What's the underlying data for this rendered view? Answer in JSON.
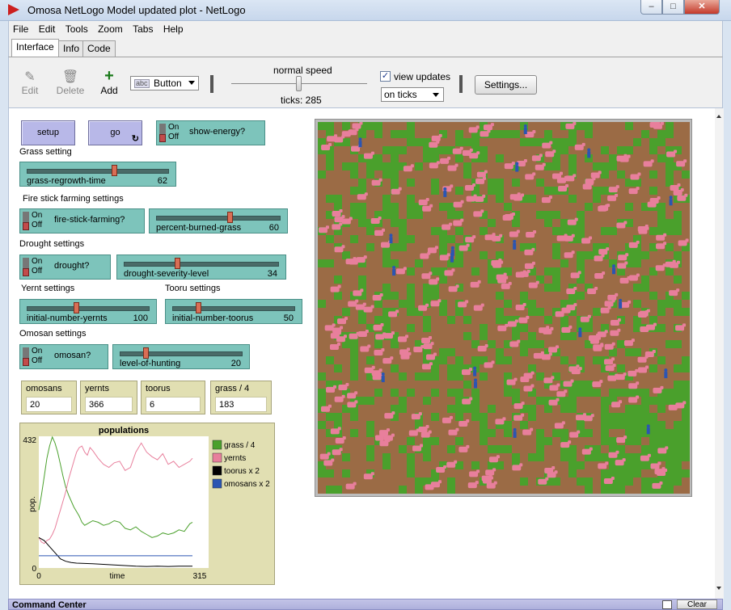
{
  "window": {
    "title": "Omosa NetLogo Model updated plot - NetLogo"
  },
  "menu": [
    "File",
    "Edit",
    "Tools",
    "Zoom",
    "Tabs",
    "Help"
  ],
  "tabs": [
    "Interface",
    "Info",
    "Code"
  ],
  "toolbar": {
    "edit": "Edit",
    "delete": "Delete",
    "add": "Add",
    "widget_type": "Button",
    "speed_label": "normal speed",
    "ticks_label": "ticks: 285",
    "speed_fraction": 0.5,
    "view_updates_label": "view updates",
    "view_updates_checked": true,
    "update_mode": "on ticks",
    "settings": "Settings..."
  },
  "buttons": {
    "setup": "setup",
    "go": "go"
  },
  "switches": {
    "show_energy": {
      "label": "show-energy?",
      "on": "On",
      "off": "Off",
      "value": false
    },
    "fire_stick": {
      "label": "fire-stick-farming?",
      "on": "On",
      "off": "Off",
      "value": false
    },
    "drought": {
      "label": "drought?",
      "on": "On",
      "off": "Off",
      "value": false
    },
    "omosan": {
      "label": "omosan?",
      "on": "On",
      "off": "Off",
      "value": false
    }
  },
  "sections": {
    "grass": "Grass setting",
    "fire": "Fire stick farming settings",
    "drought": "Drought settings",
    "yernt": "Yernt settings",
    "tooru": "Tooru settings",
    "omosan": "Omosan settings"
  },
  "sliders": {
    "grass_regrowth": {
      "name": "grass-regrowth-time",
      "value": "62",
      "fraction": 0.62
    },
    "percent_burned": {
      "name": "percent-burned-grass",
      "value": "60",
      "fraction": 0.6
    },
    "drought_severity": {
      "name": "drought-severity-level",
      "value": "34",
      "fraction": 0.34
    },
    "initial_yernts": {
      "name": "initial-number-yernts",
      "value": "100",
      "fraction": 0.4
    },
    "initial_toorus": {
      "name": "initial-number-toorus",
      "value": "50",
      "fraction": 0.2
    },
    "level_hunting": {
      "name": "level-of-hunting",
      "value": "20",
      "fraction": 0.2
    }
  },
  "monitors": [
    {
      "name": "omosans",
      "value": "20"
    },
    {
      "name": "yernts",
      "value": "366"
    },
    {
      "name": "toorus",
      "value": "6"
    },
    {
      "name": "grass / 4",
      "value": "183"
    }
  ],
  "chart_data": {
    "type": "line",
    "title": "populations",
    "xlabel": "time",
    "ylabel": "pop.",
    "xlim": [
      0,
      315
    ],
    "ylim": [
      0,
      432
    ],
    "x_ticks": [
      "0",
      "315"
    ],
    "y_ticks": [
      "0",
      "432"
    ],
    "legend_position": "right",
    "series": [
      {
        "name": "grass / 4",
        "color": "#4aa02c",
        "x": [
          0,
          5,
          10,
          15,
          20,
          25,
          30,
          35,
          40,
          45,
          50,
          55,
          60,
          65,
          70,
          75,
          80,
          85,
          90,
          95,
          100,
          110,
          120,
          130,
          140,
          150,
          160,
          170,
          180,
          190,
          200,
          210,
          220,
          230,
          240,
          250,
          260,
          270,
          280,
          285
        ],
        "y": [
          190,
          240,
          300,
          360,
          400,
          430,
          410,
          380,
          340,
          300,
          265,
          240,
          220,
          200,
          185,
          170,
          150,
          140,
          145,
          150,
          155,
          150,
          140,
          145,
          155,
          150,
          130,
          125,
          135,
          120,
          110,
          100,
          105,
          115,
          110,
          115,
          125,
          120,
          145,
          150
        ]
      },
      {
        "name": "yernts",
        "color": "#e87f9c",
        "x": [
          0,
          5,
          10,
          15,
          20,
          25,
          30,
          35,
          40,
          45,
          50,
          55,
          60,
          65,
          70,
          75,
          80,
          85,
          90,
          95,
          100,
          110,
          120,
          130,
          140,
          150,
          160,
          170,
          180,
          190,
          200,
          210,
          220,
          230,
          240,
          250,
          260,
          270,
          280,
          285
        ],
        "y": [
          100,
          85,
          80,
          90,
          95,
          110,
          130,
          160,
          190,
          220,
          250,
          290,
          320,
          350,
          380,
          395,
          400,
          380,
          370,
          395,
          385,
          360,
          340,
          330,
          345,
          350,
          320,
          330,
          380,
          410,
          380,
          365,
          355,
          375,
          340,
          350,
          330,
          340,
          350,
          360
        ]
      },
      {
        "name": "toorus x 2",
        "color": "#000000",
        "x": [
          0,
          10,
          20,
          30,
          40,
          50,
          60,
          70,
          80,
          100,
          120,
          140,
          160,
          180,
          200,
          220,
          240,
          260,
          285
        ],
        "y": [
          100,
          90,
          70,
          50,
          30,
          22,
          18,
          16,
          15,
          14,
          12,
          10,
          8,
          6,
          5,
          6,
          5,
          6,
          6
        ]
      },
      {
        "name": "omosans x 2",
        "color": "#2b55b2",
        "x": [
          0,
          285
        ],
        "y": [
          40,
          40
        ]
      }
    ]
  },
  "command_center": {
    "title": "Command Center",
    "clear": "Clear"
  },
  "colors": {
    "button": "#b8b8e8",
    "switch": "#7dc4bb",
    "monitor": "#e1dfb2",
    "soil": "#9b6b45",
    "grass_patch": "#4aa02c",
    "sheep": "#e87f9c",
    "omosan": "#2b55b2"
  }
}
